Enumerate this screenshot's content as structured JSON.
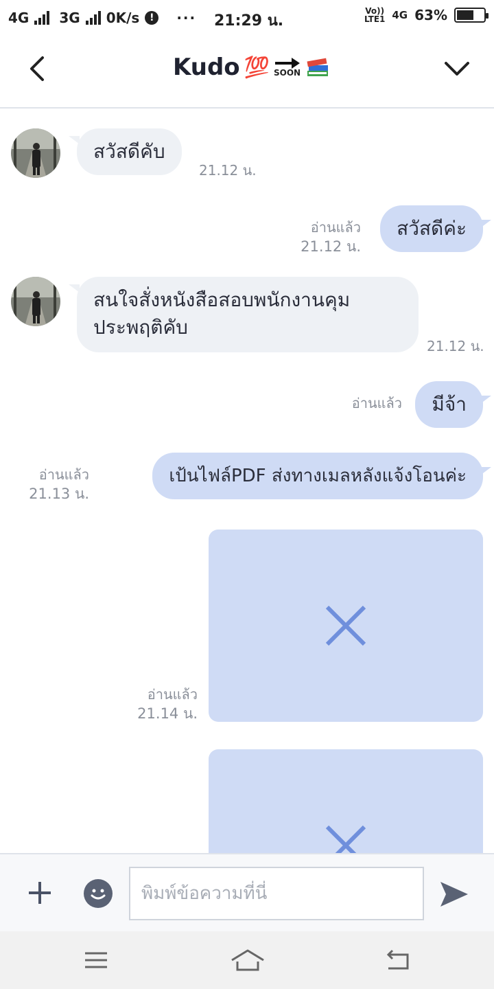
{
  "status": {
    "net1": "4G",
    "net2": "3G",
    "speed": "0K/s",
    "alert": "!",
    "more": "···",
    "time": "21:29 น.",
    "volte_top": "Vo))",
    "volte_bottom": "LTE1",
    "net3": "4G",
    "battery": "63%"
  },
  "header": {
    "title": "Kudo",
    "title_emoji": "💯",
    "soon_label": "SOON"
  },
  "messages": [
    {
      "side": "in",
      "text": "สวัสดีคับ",
      "time": "21.12 น."
    },
    {
      "side": "out",
      "text": "สวัสดีค่ะ",
      "read": "อ่านแล้ว",
      "time": "21.12 น."
    },
    {
      "side": "in",
      "text_line1": "สนใจสั่งหนังสือสอบพนักงานคุม",
      "text_line2": "ประพฤติคับ",
      "time": "21.12 น."
    },
    {
      "side": "out",
      "text": "มีจ้า",
      "read": "อ่านแล้ว"
    },
    {
      "side": "out",
      "text": "เป้นไฟล์PDF ส่งทางเมลหลังแจ้งโอนค่ะ",
      "read": "อ่านแล้ว",
      "time": "21.13 น."
    },
    {
      "side": "out",
      "type": "image",
      "read": "อ่านแล้ว",
      "time": "21.14 น."
    },
    {
      "side": "out",
      "type": "image"
    }
  ],
  "composer": {
    "placeholder": "พิมพ์ข้อความที่นี่"
  },
  "colors": {
    "bubble_in": "#eef1f5",
    "bubble_out": "#cfdbf5",
    "image_x": "#6f8fdc"
  }
}
